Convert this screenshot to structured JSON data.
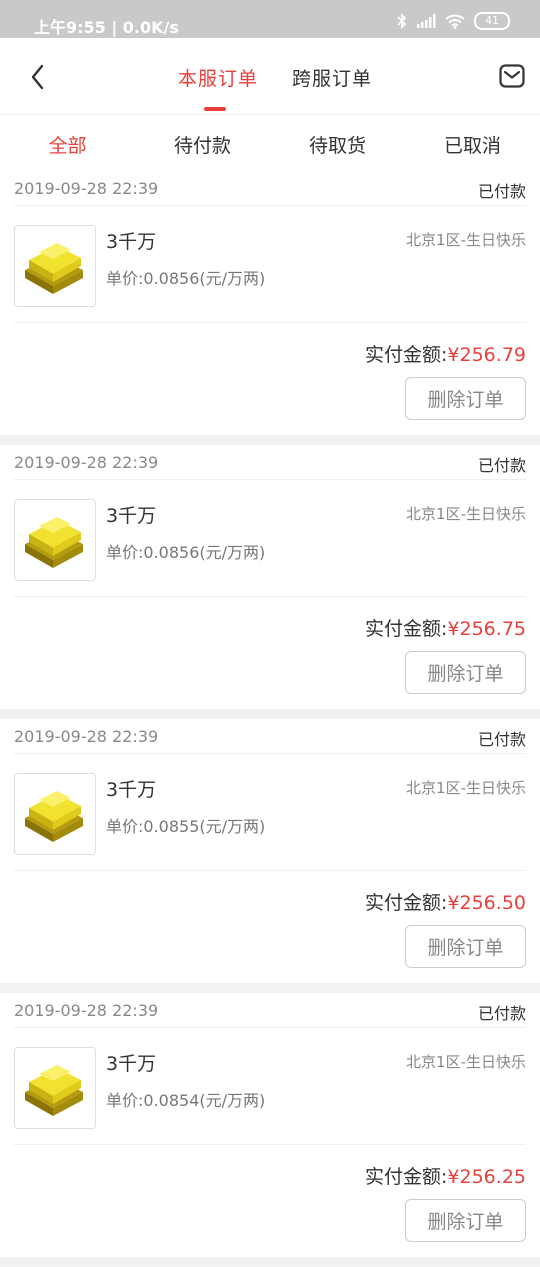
{
  "status_bar": {
    "time_speed": "上午9:55 | 0.0K/s",
    "battery": "41"
  },
  "header": {
    "tabs": [
      {
        "label": "本服订单",
        "active": true
      },
      {
        "label": "跨服订单",
        "active": false
      }
    ],
    "back_icon": "chevron-left-icon",
    "mail_icon": "mail-icon"
  },
  "filters": [
    {
      "label": "全部",
      "active": true
    },
    {
      "label": "待付款",
      "active": false
    },
    {
      "label": "待取货",
      "active": false
    },
    {
      "label": "已取消",
      "active": false
    }
  ],
  "colors": {
    "accent": "#e8413c",
    "status_bar": "#c9c9c9",
    "gold": "#e8d21e"
  },
  "orders": [
    {
      "date": "2019-09-28 22:39",
      "status": "已付款",
      "item_name": "3千万",
      "unit_price": "单价:0.0856(元/万两)",
      "server": "北京1区-生日快乐",
      "total_label": "实付金额:",
      "total_amount": "¥256.79",
      "delete_label": "删除订单"
    },
    {
      "date": "2019-09-28 22:39",
      "status": "已付款",
      "item_name": "3千万",
      "unit_price": "单价:0.0856(元/万两)",
      "server": "北京1区-生日快乐",
      "total_label": "实付金额:",
      "total_amount": "¥256.75",
      "delete_label": "删除订单"
    },
    {
      "date": "2019-09-28 22:39",
      "status": "已付款",
      "item_name": "3千万",
      "unit_price": "单价:0.0855(元/万两)",
      "server": "北京1区-生日快乐",
      "total_label": "实付金额:",
      "total_amount": "¥256.50",
      "delete_label": "删除订单"
    },
    {
      "date": "2019-09-28 22:39",
      "status": "已付款",
      "item_name": "3千万",
      "unit_price": "单价:0.0854(元/万两)",
      "server": "北京1区-生日快乐",
      "total_label": "实付金额:",
      "total_amount": "¥256.25",
      "delete_label": "删除订单"
    }
  ]
}
